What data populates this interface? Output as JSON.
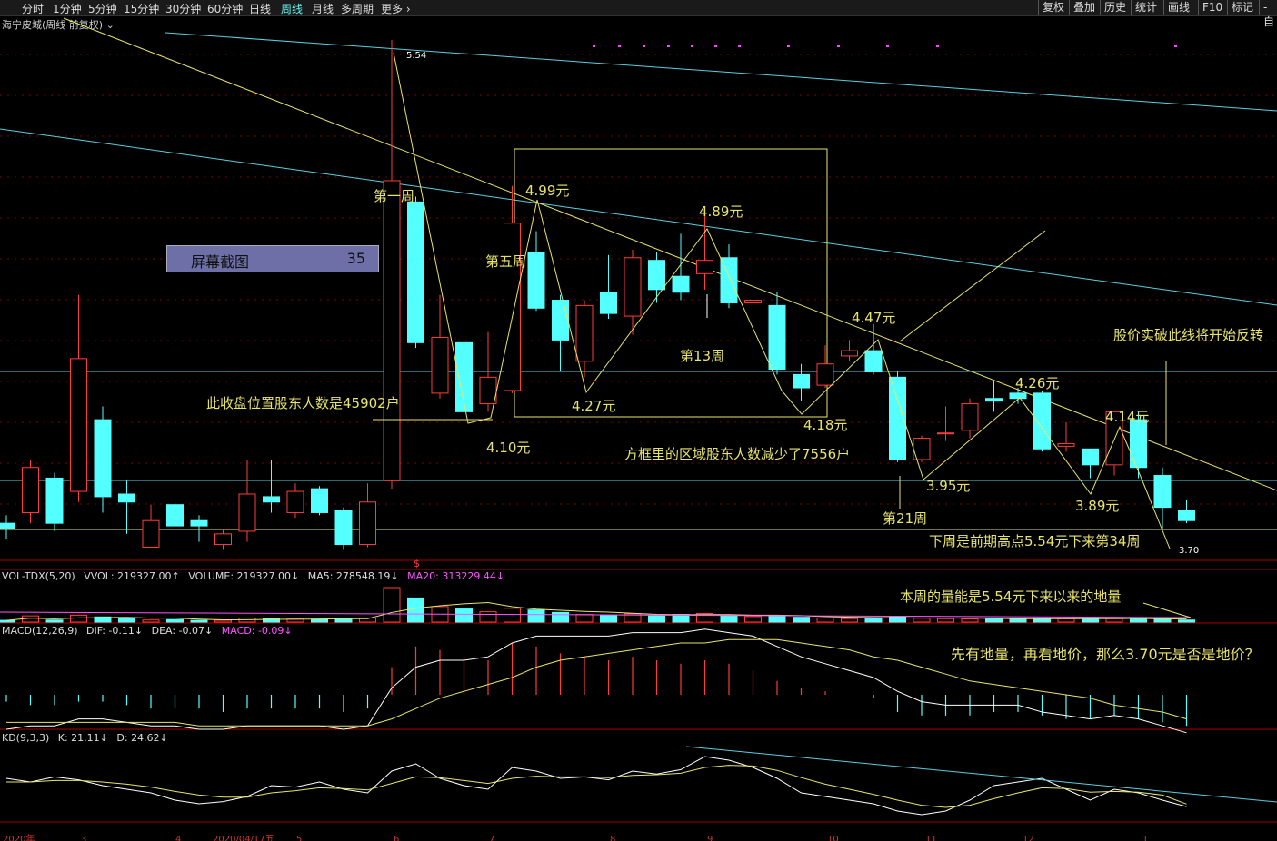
{
  "toolbar": {
    "periods": [
      "分时",
      "1分钟",
      "5分钟",
      "15分钟",
      "30分钟",
      "60分钟",
      "日线",
      "周线",
      "月线",
      "多周期",
      "更多"
    ],
    "active_period": "周线",
    "right_buttons": [
      "复权",
      "叠加",
      "历史",
      "统计",
      "画线",
      "F10",
      "标记",
      "-自"
    ]
  },
  "panel_title": "海宁皮城(周线 前复权)",
  "screenshot_badge": {
    "label": "屏幕截图",
    "value": "35"
  },
  "volume_line": {
    "name": "VOL-TDX(5,20)",
    "vvol": "VVOL: 219327.00↑",
    "volume": "VOLUME: 219327.00↓",
    "ma5": "MA5: 278548.19↓",
    "ma20": "MA20: 313229.44↓"
  },
  "macd_line": {
    "name": "MACD(12,26,9)",
    "dif": "DIF: -0.11↓",
    "dea": "DEA: -0.07↓",
    "macd": "MACD: -0.09↓"
  },
  "kd_line": {
    "name": "KD(9,3,3)",
    "k": "K: 21.11↓",
    "d": "D: 24.62↓"
  },
  "colors": {
    "up": "#ff3b3b",
    "down": "#54ffff",
    "annotation": "#e8e46a",
    "trend": "#58d0e0",
    "ma20": "#ff55ff"
  },
  "annotations": {
    "week1": "第一周",
    "week5": "第五周",
    "week13": "第13周",
    "week21": "第21周",
    "p499": "4.99元",
    "p489": "4.89元",
    "p447": "4.47元",
    "p426": "4.26元",
    "p414": "4.14元",
    "p427": "4.27元",
    "p410": "4.10元",
    "p418": "4.18元",
    "p395": "3.95元",
    "p389": "3.89元",
    "high": "5.54",
    "low": "3.70",
    "holders": "此收盘位置股东人数是45902户",
    "box": "方框里的区域股东人数减少了7556户",
    "next_week": "下周是前期高点5.54元下来第34周",
    "breakout": "股价实破此线将开始反转",
    "volume_note": "本周的量能是5.54元下来以来的地量",
    "question": "先有地量，再看地价，那么3.70元是否是地价？",
    "dollar": "$"
  },
  "x_axis_labels": [
    "2020年",
    "3",
    "4",
    "2020/04/17五",
    "5",
    "6",
    "7",
    "8",
    "9",
    "10",
    "11",
    "12",
    "1"
  ],
  "chart_data": {
    "type": "candlestick",
    "x_unit": "week",
    "price_range": [
      3.5,
      5.7
    ],
    "candles": [
      {
        "o": 3.72,
        "c": 3.7,
        "h": 3.75,
        "l": 3.66
      },
      {
        "o": 3.76,
        "c": 3.93,
        "h": 3.96,
        "l": 3.72
      },
      {
        "o": 3.89,
        "c": 3.72,
        "h": 3.91,
        "l": 3.69
      },
      {
        "o": 3.84,
        "c": 4.34,
        "h": 4.58,
        "l": 3.8
      },
      {
        "o": 4.11,
        "c": 3.82,
        "h": 4.16,
        "l": 3.76
      },
      {
        "o": 3.83,
        "c": 3.8,
        "h": 3.88,
        "l": 3.68
      },
      {
        "o": 3.63,
        "c": 3.73,
        "h": 3.79,
        "l": 3.63
      },
      {
        "o": 3.79,
        "c": 3.71,
        "h": 3.81,
        "l": 3.64
      },
      {
        "o": 3.73,
        "c": 3.71,
        "h": 3.75,
        "l": 3.65
      },
      {
        "o": 3.64,
        "c": 3.68,
        "h": 3.7,
        "l": 3.62
      },
      {
        "o": 3.69,
        "c": 3.83,
        "h": 3.96,
        "l": 3.65
      },
      {
        "o": 3.82,
        "c": 3.8,
        "h": 3.96,
        "l": 3.76
      },
      {
        "o": 3.76,
        "c": 3.84,
        "h": 3.87,
        "l": 3.74
      },
      {
        "o": 3.85,
        "c": 3.76,
        "h": 3.86,
        "l": 3.75
      },
      {
        "o": 3.77,
        "c": 3.64,
        "h": 3.78,
        "l": 3.62
      },
      {
        "o": 3.64,
        "c": 3.8,
        "h": 3.87,
        "l": 3.63
      },
      {
        "o": 3.88,
        "c": 5.01,
        "h": 5.54,
        "l": 3.85
      },
      {
        "o": 4.93,
        "c": 4.4,
        "h": 4.95,
        "l": 4.38
      },
      {
        "o": 4.21,
        "c": 4.42,
        "h": 4.58,
        "l": 4.19
      },
      {
        "o": 4.4,
        "c": 4.14,
        "h": 4.41,
        "l": 4.1
      },
      {
        "o": 4.17,
        "c": 4.27,
        "h": 4.44,
        "l": 4.14
      },
      {
        "o": 4.22,
        "c": 4.85,
        "h": 4.99,
        "l": 4.21
      },
      {
        "o": 4.74,
        "c": 4.53,
        "h": 4.82,
        "l": 4.52
      },
      {
        "o": 4.56,
        "c": 4.41,
        "h": 4.58,
        "l": 4.29
      },
      {
        "o": 4.33,
        "c": 4.54,
        "h": 4.56,
        "l": 4.27
      },
      {
        "o": 4.59,
        "c": 4.51,
        "h": 4.73,
        "l": 4.49
      },
      {
        "o": 4.5,
        "c": 4.72,
        "h": 4.75,
        "l": 4.43
      },
      {
        "o": 4.71,
        "c": 4.6,
        "h": 4.74,
        "l": 4.55
      },
      {
        "o": 4.65,
        "c": 4.59,
        "h": 4.81,
        "l": 4.56
      },
      {
        "o": 4.66,
        "c": 4.71,
        "h": 4.89,
        "l": 4.6
      },
      {
        "o": 4.72,
        "c": 4.55,
        "h": 4.77,
        "l": 4.53
      },
      {
        "o": 4.55,
        "c": 4.56,
        "h": 4.57,
        "l": 4.46
      },
      {
        "o": 4.54,
        "c": 4.3,
        "h": 4.59,
        "l": 4.28
      },
      {
        "o": 4.28,
        "c": 4.23,
        "h": 4.32,
        "l": 4.18
      },
      {
        "o": 4.24,
        "c": 4.32,
        "h": 4.39,
        "l": 4.23
      },
      {
        "o": 4.35,
        "c": 4.37,
        "h": 4.41,
        "l": 4.33
      },
      {
        "o": 4.37,
        "c": 4.29,
        "h": 4.47,
        "l": 4.28
      },
      {
        "o": 4.27,
        "c": 3.96,
        "h": 4.29,
        "l": 3.95
      },
      {
        "o": 3.96,
        "c": 4.04,
        "h": 4.05,
        "l": 3.95
      },
      {
        "o": 4.06,
        "c": 4.06,
        "h": 4.16,
        "l": 4.03
      },
      {
        "o": 4.07,
        "c": 4.17,
        "h": 4.19,
        "l": 4.04
      },
      {
        "o": 4.19,
        "c": 4.18,
        "h": 4.26,
        "l": 4.14
      },
      {
        "o": 4.21,
        "c": 4.19,
        "h": 4.23,
        "l": 4.17
      },
      {
        "o": 4.21,
        "c": 4.0,
        "h": 4.22,
        "l": 3.99
      },
      {
        "o": 4.01,
        "c": 4.02,
        "h": 4.1,
        "l": 3.99
      },
      {
        "o": 4.0,
        "c": 3.94,
        "h": 4.0,
        "l": 3.89
      },
      {
        "o": 3.94,
        "c": 4.14,
        "h": 4.14,
        "l": 3.9
      },
      {
        "o": 4.11,
        "c": 3.93,
        "h": 4.14,
        "l": 3.89
      },
      {
        "o": 3.9,
        "c": 3.78,
        "h": 3.93,
        "l": 3.7
      },
      {
        "o": 3.77,
        "c": 3.73,
        "h": 3.81,
        "l": 3.72
      }
    ],
    "volume": [
      0.05,
      0.18,
      0.06,
      0.2,
      0.15,
      0.1,
      0.06,
      0.07,
      0.05,
      0.05,
      0.12,
      0.1,
      0.09,
      0.08,
      0.1,
      0.12,
      1.0,
      0.7,
      0.45,
      0.38,
      0.3,
      0.4,
      0.35,
      0.28,
      0.22,
      0.2,
      0.24,
      0.18,
      0.22,
      0.25,
      0.2,
      0.16,
      0.18,
      0.14,
      0.12,
      0.1,
      0.12,
      0.15,
      0.11,
      0.1,
      0.09,
      0.09,
      0.1,
      0.12,
      0.1,
      0.09,
      0.1,
      0.11,
      0.08,
      0.06
    ],
    "macd": [
      -0.02,
      -0.03,
      -0.03,
      -0.02,
      -0.02,
      -0.03,
      -0.04,
      -0.04,
      -0.04,
      -0.05,
      -0.04,
      -0.04,
      -0.04,
      -0.04,
      -0.05,
      -0.04,
      0.08,
      0.14,
      0.13,
      0.11,
      0.1,
      0.15,
      0.14,
      0.12,
      0.11,
      0.1,
      0.11,
      0.1,
      0.09,
      0.1,
      0.09,
      0.07,
      0.04,
      0.02,
      0.01,
      0.0,
      -0.01,
      -0.05,
      -0.06,
      -0.06,
      -0.06,
      -0.05,
      -0.05,
      -0.06,
      -0.07,
      -0.07,
      -0.06,
      -0.07,
      -0.08,
      -0.09
    ],
    "dif": [
      -0.1,
      -0.09,
      -0.09,
      -0.07,
      -0.07,
      -0.08,
      -0.09,
      -0.09,
      -0.1,
      -0.1,
      -0.09,
      -0.09,
      -0.09,
      -0.09,
      -0.1,
      -0.09,
      0.02,
      0.08,
      0.1,
      0.1,
      0.11,
      0.15,
      0.17,
      0.17,
      0.17,
      0.17,
      0.18,
      0.18,
      0.18,
      0.19,
      0.18,
      0.17,
      0.14,
      0.11,
      0.09,
      0.07,
      0.05,
      0.01,
      -0.02,
      -0.03,
      -0.03,
      -0.03,
      -0.03,
      -0.05,
      -0.06,
      -0.07,
      -0.06,
      -0.07,
      -0.09,
      -0.11
    ],
    "dea": [
      -0.08,
      -0.08,
      -0.08,
      -0.08,
      -0.08,
      -0.08,
      -0.08,
      -0.08,
      -0.09,
      -0.09,
      -0.09,
      -0.09,
      -0.09,
      -0.09,
      -0.09,
      -0.09,
      -0.07,
      -0.04,
      -0.01,
      0.01,
      0.03,
      0.05,
      0.08,
      0.1,
      0.11,
      0.12,
      0.13,
      0.14,
      0.15,
      0.15,
      0.16,
      0.16,
      0.16,
      0.15,
      0.14,
      0.13,
      0.11,
      0.1,
      0.08,
      0.06,
      0.04,
      0.03,
      0.02,
      0.01,
      0.0,
      -0.01,
      -0.03,
      -0.04,
      -0.05,
      -0.07
    ],
    "k": [
      60,
      55,
      62,
      58,
      50,
      45,
      40,
      30,
      25,
      28,
      35,
      50,
      48,
      55,
      45,
      40,
      70,
      80,
      60,
      50,
      45,
      75,
      70,
      60,
      62,
      58,
      70,
      66,
      72,
      90,
      85,
      75,
      60,
      40,
      35,
      30,
      25,
      15,
      10,
      15,
      30,
      50,
      55,
      60,
      45,
      30,
      45,
      40,
      30,
      21.11
    ],
    "d": [
      55,
      55,
      57,
      57,
      55,
      52,
      48,
      42,
      37,
      34,
      34,
      40,
      43,
      47,
      46,
      44,
      53,
      62,
      61,
      57,
      53,
      60,
      63,
      62,
      62,
      61,
      64,
      65,
      67,
      75,
      78,
      77,
      71,
      61,
      52,
      45,
      38,
      30,
      23,
      20,
      23,
      32,
      40,
      47,
      46,
      41,
      42,
      41,
      37,
      24.62
    ]
  }
}
